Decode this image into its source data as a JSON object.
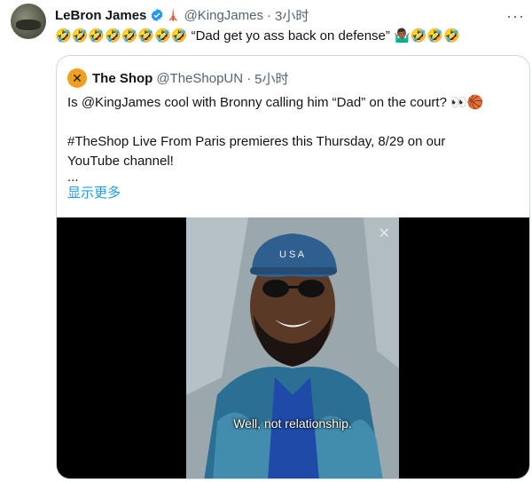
{
  "tweet": {
    "author_name": "LeBron James",
    "author_handle": "@KingJames",
    "time": "3小时",
    "text_prefix_emoji": "🤣🤣🤣🤣🤣🤣🤣🤣",
    "text": "“Dad get yo ass back on defense”",
    "text_suffix_emoji": "🤷🏾‍♂️🤣🤣🤣",
    "tag_emoji": "🗼"
  },
  "quote": {
    "author_name": "The Shop",
    "author_handle": "@TheShopUN",
    "time": "5小时",
    "line1": "Is @KingJames cool with Bronny calling him “Dad” on the court? 👀🏀",
    "line2": "#TheShop Live From Paris premieres this Thursday, 8/29 on our",
    "line3": "YouTube channel!",
    "line4": "...",
    "show_more": "显示更多",
    "video_caption": "Well, not relationship."
  },
  "colors": {
    "link": "#1d9bf0",
    "muted": "#536471",
    "verified": "#1d9bf0"
  }
}
